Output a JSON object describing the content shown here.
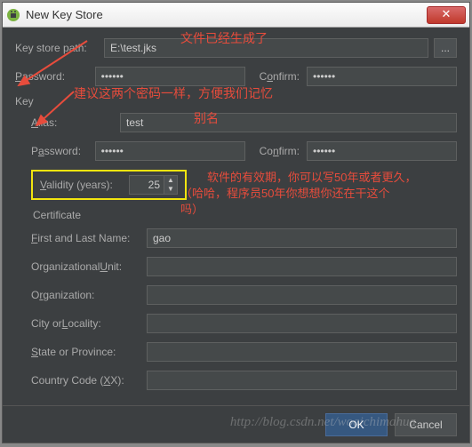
{
  "window": {
    "title": "New Key Store"
  },
  "keystore": {
    "path_label": "Key store path:",
    "path_value": "E:\\test.jks",
    "password_label": "Password:",
    "password_value": "••••••",
    "confirm_label": "Confirm:",
    "confirm_value": "••••••"
  },
  "key": {
    "section_label": "Key",
    "alias_label": "Alias:",
    "alias_value": "test",
    "password_label": "Password:",
    "password_value": "••••••",
    "confirm_label": "Confirm:",
    "confirm_value": "••••••",
    "validity_label": "Validity (years):",
    "validity_value": "25",
    "certificate_label": "Certificate",
    "first_last_label": "First and Last Name:",
    "first_last_value": "gao",
    "org_unit_label": "Organizational Unit:",
    "org_unit_value": "",
    "org_label": "Organization:",
    "org_value": "",
    "city_label": "City or Locality:",
    "city_value": "",
    "state_label": "State or Province:",
    "state_value": "",
    "country_label": "Country Code (XX):",
    "country_value": ""
  },
  "buttons": {
    "ok": "OK",
    "cancel": "Cancel",
    "browse": "..."
  },
  "annotations": {
    "file_generated": "文件已经生成了",
    "same_password": "建议这两个密码一样，方便我们记忆",
    "alias": "别名",
    "validity1": "软件的有效期，你可以写50年或者更久，",
    "validity2": "（哈哈，程序员50年你想想你还在干这个",
    "validity3": "吗）"
  },
  "watermark": "http://blog.csdn.net/woaichimahua",
  "colors": {
    "accent": "#365880",
    "highlight": "#f1e40f",
    "annot": "#e74c3c"
  }
}
